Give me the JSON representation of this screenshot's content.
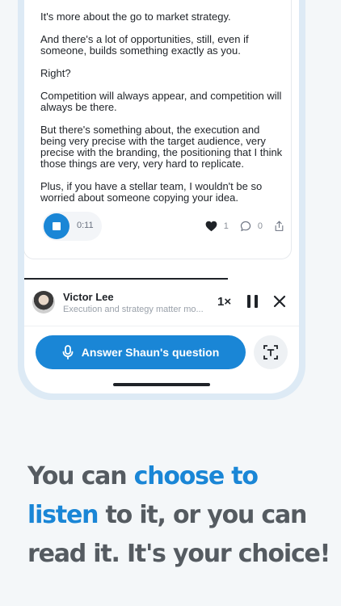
{
  "transcript": [
    "It's more about the go to market strategy.",
    "And there's a lot of opportunities, still, even if someone, builds something exactly as you.",
    "Right?",
    "Competition will always appear, and competition will always be there.",
    "But there's something about, the execution and being very precise with the target audience, very precise with the branding, the positioning that I think those things are very, very hard to replicate.",
    "Plus, if you have a stellar team, I wouldn't be so worried about someone copying your idea."
  ],
  "player": {
    "time": "0:11",
    "likes": "1",
    "comments": "0"
  },
  "now_playing": {
    "name": "Victor Lee",
    "subtitle": "Execution and strategy matter mo...",
    "speed": "1×"
  },
  "answer_button": "Answer Shaun's question",
  "tagline": {
    "part1": "You can ",
    "highlight": "choose to listen",
    "part2": " to it, or you can read it. It's your choice!"
  },
  "colors": {
    "accent": "#1a86d6",
    "tagline_text": "#555b61",
    "background": "#f4f7f9",
    "frame": "#ddeaf5"
  },
  "icons": [
    "stop-icon",
    "heart-icon",
    "comment-icon",
    "share-icon",
    "pause-icon",
    "close-icon",
    "mic-icon",
    "transcribe-icon"
  ]
}
